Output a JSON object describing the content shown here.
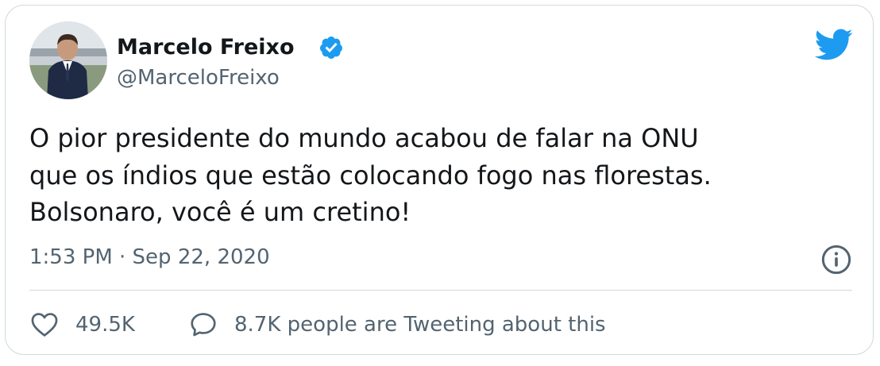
{
  "author": {
    "name": "Marcelo Freixo",
    "handle": "@MarceloFreixo"
  },
  "tweet": {
    "text_lines": [
      "O pior presidente do mundo acabou de falar na ONU",
      "que os índios que estão colocando fogo nas florestas.",
      "Bolsonaro, você é um cretino!"
    ],
    "timestamp": "1:53 PM · Sep 22, 2020"
  },
  "engagement": {
    "likes": "49.5K",
    "tweeting": "8.7K people are Tweeting about this"
  },
  "icons": {
    "verified": "verified-badge-icon",
    "brand": "twitter-bird-icon",
    "info": "info-icon",
    "like": "heart-icon",
    "reply": "speech-bubble-icon"
  },
  "colors": {
    "brand": "#1d9bf0",
    "text": "#14171a",
    "secondary": "#536471",
    "border": "#cfd9de"
  }
}
